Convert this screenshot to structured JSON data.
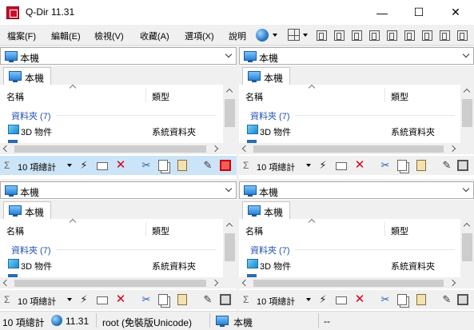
{
  "window": {
    "title": "Q-Dir 11.31",
    "minimize": "—",
    "maximize": "☐",
    "close": "✕"
  },
  "menubar": {
    "items": [
      "檔案(F)",
      "編輯(E)",
      "檢視(V)",
      "收藏(A)",
      "選項(X)",
      "說明"
    ]
  },
  "panes": [
    {
      "address": "本機",
      "tab": "本機",
      "col_name": "名稱",
      "col_type": "類型",
      "group": "資料夾 (7)",
      "row_name": "3D 物件",
      "row_type": "系統資料夾",
      "count": "10 項總計",
      "sum": "Σ",
      "active": true
    },
    {
      "address": "本機",
      "tab": "本機",
      "col_name": "名稱",
      "col_type": "類型",
      "group": "資料夾 (7)",
      "row_name": "3D 物件",
      "row_type": "系統資料夾",
      "count": "10 項總計",
      "sum": "Σ",
      "active": false
    },
    {
      "address": "本機",
      "tab": "本機",
      "col_name": "名稱",
      "col_type": "類型",
      "group": "資料夾 (7)",
      "row_name": "3D 物件",
      "row_type": "系統資料夾",
      "count": "10 項總計",
      "sum": "Σ",
      "active": false
    },
    {
      "address": "本機",
      "tab": "本機",
      "col_name": "名稱",
      "col_type": "類型",
      "group": "資料夾 (7)",
      "row_name": "3D 物件",
      "row_type": "系統資料夾",
      "count": "10 項總計",
      "sum": "Σ",
      "active": false
    }
  ],
  "pane_toolbar_icons": [
    "lightning-icon",
    "envelope-icon",
    "delete-icon",
    "cut-icon",
    "copy-icon",
    "paste-icon",
    "pen-icon",
    "frame-icon"
  ],
  "status": {
    "count": "10 項總計",
    "version": "11.31",
    "user": "root (免裝版Unicode)",
    "location": "本機",
    "extra": "--"
  },
  "colors": {
    "active_status": "#cce4f7",
    "group_text": "#1e4fb0",
    "delete": "#d0021b"
  }
}
